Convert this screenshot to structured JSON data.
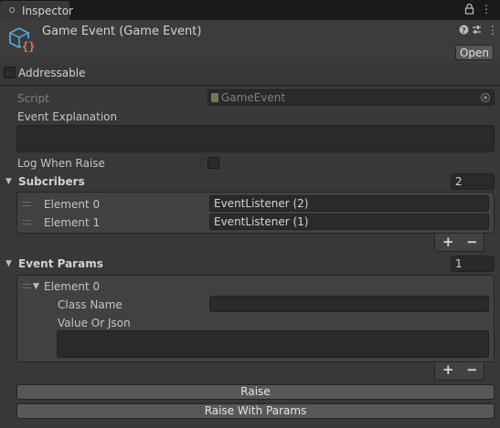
{
  "tab": {
    "label": "Inspector"
  },
  "header": {
    "title": "Game Event (Game Event)",
    "open_label": "Open"
  },
  "addressable": {
    "label": "Addressable",
    "checked": false
  },
  "script": {
    "label": "Script",
    "value": "GameEvent"
  },
  "event_explanation": {
    "label": "Event Explanation",
    "value": ""
  },
  "log_when_raise": {
    "label": "Log When Raise",
    "checked": false
  },
  "subscribers": {
    "label": "Subcribers",
    "size": "2",
    "elements": [
      {
        "label": "Element 0",
        "value": "EventListener (2)"
      },
      {
        "label": "Element 1",
        "value": "EventListener (1)"
      }
    ]
  },
  "event_params": {
    "label": "Event Params",
    "size": "1",
    "element": {
      "label": "Element 0",
      "class_name_label": "Class Name",
      "class_name_value": "",
      "value_label": "Value Or Json",
      "value_value": ""
    }
  },
  "list_controls": {
    "add": "+",
    "remove": "−"
  },
  "buttons": {
    "raise": "Raise",
    "raise_with_params": "Raise With Params"
  }
}
